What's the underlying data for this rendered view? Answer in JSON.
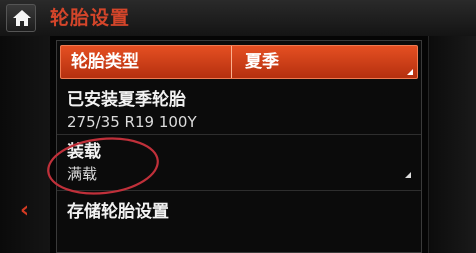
{
  "header": {
    "title": "轮胎设置"
  },
  "menu": {
    "tire_type": {
      "label": "轮胎类型",
      "value": "夏季"
    },
    "installed": {
      "title": "已安装夏季轮胎",
      "spec": "275/35 R19 100Y"
    },
    "load": {
      "title": "装载",
      "value": "满载"
    },
    "save": {
      "title": "存储轮胎设置"
    }
  },
  "icons": {
    "home": "home-icon",
    "back": "chevron-left-icon"
  },
  "colors": {
    "accent": "#d4452a",
    "highlight": "#e54f22",
    "annotation": "#c0303a"
  }
}
